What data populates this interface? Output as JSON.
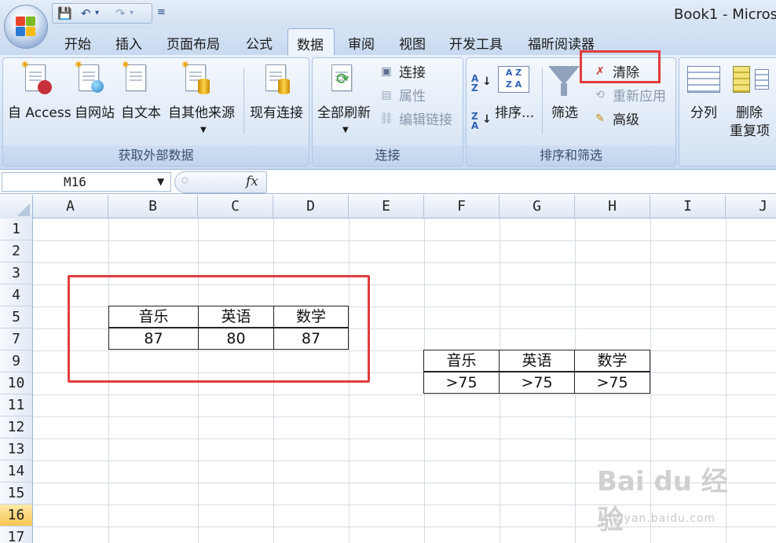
{
  "window": {
    "title": "Book1 - Micros"
  },
  "qat": {
    "save_icon": "save-icon",
    "undo_icon": "undo-icon",
    "redo_icon": "redo-icon",
    "customize_icon": "customize-qat-icon"
  },
  "tabs": [
    "开始",
    "插入",
    "页面布局",
    "公式",
    "数据",
    "审阅",
    "视图",
    "开发工具",
    "福昕阅读器"
  ],
  "active_tab": "数据",
  "ribbon": {
    "external": {
      "footer": "获取外部数据",
      "access": "自 Access",
      "web": "自网站",
      "text": "自文本",
      "other": "自其他来源",
      "existing": "现有连接"
    },
    "connections": {
      "footer": "连接",
      "refresh_all": "全部刷新",
      "connections": "连接",
      "properties": "属性",
      "edit_links": "编辑链接"
    },
    "sort_filter": {
      "footer": "排序和筛选",
      "sort": "排序...",
      "filter": "筛选",
      "clear": "清除",
      "reapply": "重新应用",
      "advanced": "高级"
    },
    "data_tools": {
      "split": "分列",
      "remove_dup_1": "删除",
      "remove_dup_2": "重复项"
    }
  },
  "formula_bar": {
    "name_box": "M16",
    "fx": "fx",
    "formula": ""
  },
  "sheet": {
    "columns": [
      "A",
      "B",
      "C",
      "D",
      "E",
      "F",
      "G",
      "H",
      "I",
      "J"
    ],
    "rows": [
      "1",
      "2",
      "3",
      "4",
      "5",
      "7",
      "9",
      "10",
      "11",
      "12",
      "13",
      "14",
      "15",
      "16",
      "17"
    ],
    "selected_row": "16",
    "table1": {
      "headers": [
        "音乐",
        "英语",
        "数学"
      ],
      "values": [
        "87",
        "80",
        "87"
      ]
    },
    "criteria": {
      "headers": [
        "音乐",
        "英语",
        "数学"
      ],
      "values": [
        ">75",
        ">75",
        ">75"
      ]
    }
  },
  "watermark": {
    "main": "Bai du 经验",
    "sub": "jingyan.baidu.com"
  },
  "colors": {
    "highlight_box": "#e03d3d",
    "ribbon_blue": "#d6e4f5",
    "selected_row": "#f8c552"
  }
}
